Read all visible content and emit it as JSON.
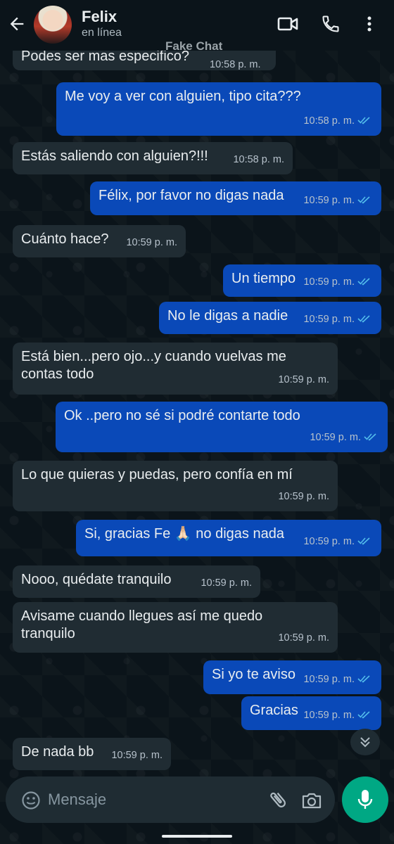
{
  "header": {
    "contact_name": "Felix",
    "status": "en línea",
    "watermark": "Fake Chat"
  },
  "messages": [
    {
      "dir": "in",
      "text": "Podes ser mas especifico?",
      "time": "10:58 p. m."
    },
    {
      "dir": "out",
      "text": "Me voy a ver con alguien, tipo cita???",
      "time": "10:58 p. m."
    },
    {
      "dir": "in",
      "text": "Estás saliendo con alguien?!!!",
      "time": "10:58 p. m."
    },
    {
      "dir": "out",
      "text": "Félix, por favor no digas nada",
      "time": "10:59 p. m."
    },
    {
      "dir": "in",
      "text": "Cuánto hace?",
      "time": "10:59 p. m."
    },
    {
      "dir": "out",
      "text": "Un tiempo",
      "time": "10:59 p. m."
    },
    {
      "dir": "out",
      "text": "No le digas a nadie",
      "time": "10:59 p. m."
    },
    {
      "dir": "in",
      "text": "Está bien...pero ojo...y cuando vuelvas me contas todo",
      "time": "10:59 p. m."
    },
    {
      "dir": "out",
      "text": "Ok ..pero no sé si podré contarte todo",
      "time": "10:59 p. m."
    },
    {
      "dir": "in",
      "text": "Lo que quieras y puedas, pero confía en mí",
      "time": "10:59 p. m."
    },
    {
      "dir": "out",
      "text": "Si, gracias Fe 🙏🏻 no digas nada",
      "time": "10:59 p. m."
    },
    {
      "dir": "in",
      "text": "Nooo, quédate tranquilo",
      "time": "10:59 p. m."
    },
    {
      "dir": "in",
      "text": "Avisame cuando llegues así me quedo tranquilo",
      "time": "10:59 p. m."
    },
    {
      "dir": "out",
      "text": "Si yo te aviso",
      "time": "10:59 p. m."
    },
    {
      "dir": "out",
      "text": "Gracias",
      "time": "10:59 p. m."
    },
    {
      "dir": "in",
      "text": "De nada bb",
      "time": "10:59 p. m."
    }
  ],
  "composer": {
    "placeholder": "Mensaje"
  },
  "icons": {
    "back": "arrow-left-icon",
    "video": "video-call-icon",
    "call": "phone-icon",
    "more": "more-vertical-icon",
    "emoji": "emoji-icon",
    "attach": "paperclip-icon",
    "camera": "camera-icon",
    "mic": "microphone-icon",
    "scroll": "double-chevron-down-icon",
    "read": "double-check-icon"
  },
  "colors": {
    "outgoing_bubble": "#0a49b8",
    "incoming_bubble": "#202c33",
    "read_ticks": "#53bdeb",
    "mic_button": "#00a884"
  }
}
